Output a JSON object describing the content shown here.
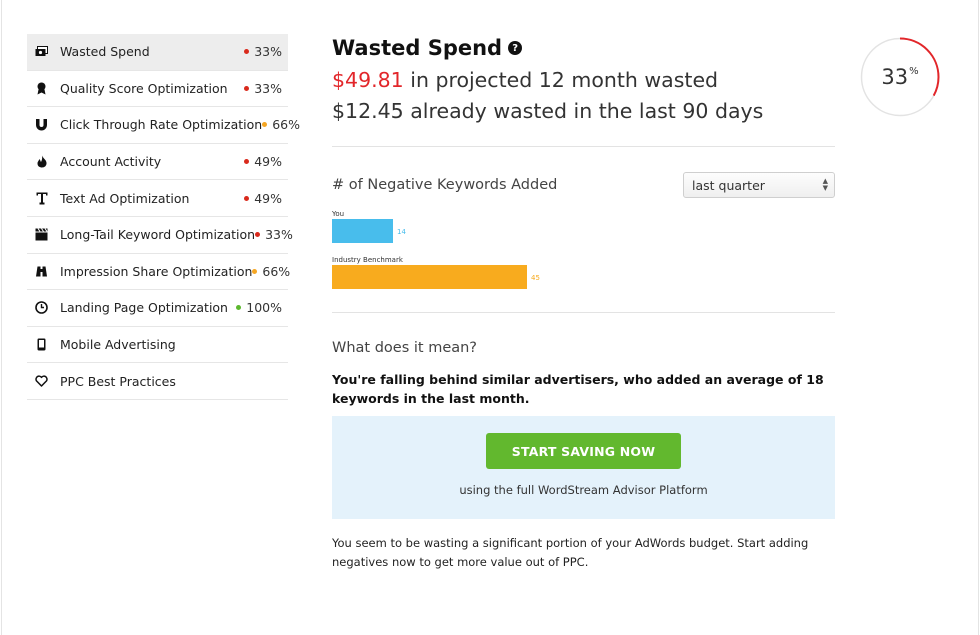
{
  "sidebar": {
    "items": [
      {
        "label": "Wasted Spend",
        "score": "33%",
        "status_color": "#d92a1c",
        "icon": "money-icon",
        "active": true
      },
      {
        "label": "Quality Score Optimization",
        "score": "33%",
        "status_color": "#d92a1c",
        "icon": "award-ribbon-icon"
      },
      {
        "label": "Click Through Rate Optimization",
        "score": "66%",
        "status_color": "#f5a623",
        "icon": "magnet-icon"
      },
      {
        "label": "Account Activity",
        "score": "49%",
        "status_color": "#d92a1c",
        "icon": "flame-icon"
      },
      {
        "label": "Text Ad Optimization",
        "score": "49%",
        "status_color": "#d92a1c",
        "icon": "text-icon"
      },
      {
        "label": "Long-Tail Keyword Optimization",
        "score": "33%",
        "status_color": "#d92a1c",
        "icon": "clapperboard-icon"
      },
      {
        "label": "Impression Share Optimization",
        "score": "66%",
        "status_color": "#f5a623",
        "icon": "binoculars-icon"
      },
      {
        "label": "Landing Page Optimization",
        "score": "100%",
        "status_color": "#5cb82e",
        "icon": "clock-icon"
      },
      {
        "label": "Mobile Advertising",
        "score": "",
        "status_color": "",
        "icon": "mobile-phone-icon"
      },
      {
        "label": "PPC Best Practices",
        "score": "",
        "status_color": "",
        "icon": "heart-icon"
      }
    ]
  },
  "main": {
    "title": "Wasted Spend",
    "projected_amount": "$49.81",
    "projected_text": " in projected 12 month wasted",
    "already_wasted": "$12.45 already wasted in the last 90 days",
    "keywords_title": "# of Negative Keywords Added",
    "period_select": "last quarter",
    "question": "What does it mean?",
    "explanation": "You're falling behind similar advertisers, who added an average of 18 keywords in the last month.",
    "cta_button": "START SAVING NOW",
    "cta_subtext": "using the full WordStream Advisor Platform",
    "footer": "You seem to be wasting a significant portion of your AdWords budget. Start adding negatives now to get more value out of PPC."
  },
  "gauge": {
    "value": "33",
    "unit": "%",
    "percent": 33,
    "color": "#e2262a"
  },
  "chart_data": {
    "type": "bar",
    "orientation": "horizontal",
    "categories": [
      "You",
      "Industry Benchmark"
    ],
    "values": [
      14,
      45
    ],
    "colors": [
      "#48bdec",
      "#f8ab1e"
    ],
    "value_max": 45
  }
}
